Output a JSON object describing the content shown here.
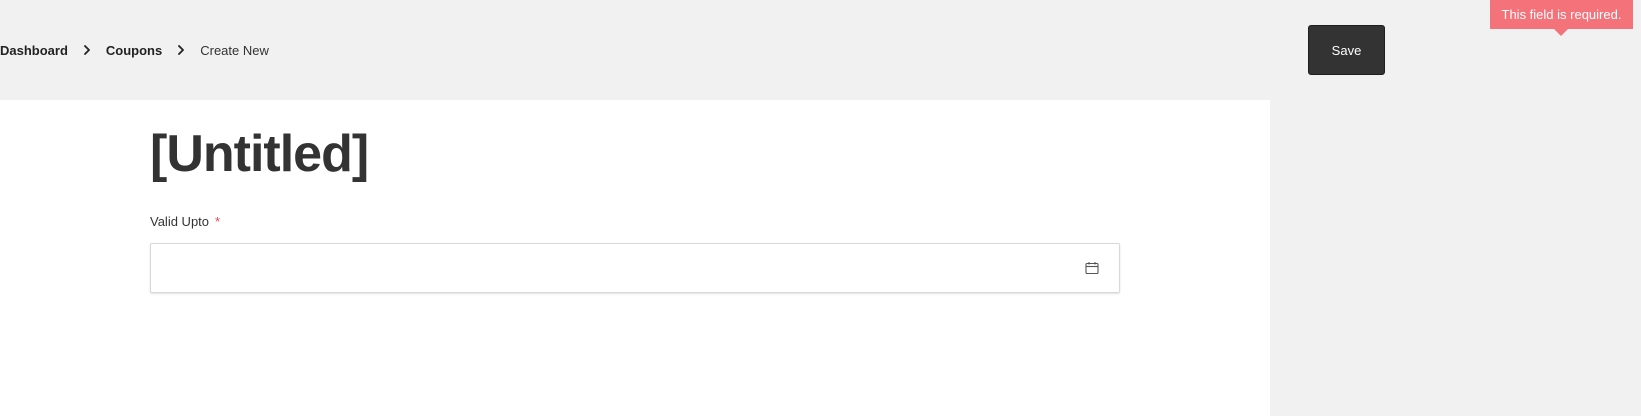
{
  "breadcrumb": {
    "items": [
      {
        "label": "Dashboard"
      },
      {
        "label": "Coupons"
      },
      {
        "label": "Create New"
      }
    ]
  },
  "toolbar": {
    "save_label": "Save"
  },
  "tooltip": {
    "text": "This field is required."
  },
  "form": {
    "title": "[Untitled]",
    "fields": [
      {
        "label": "Valid Upto",
        "required_marker": "*",
        "value": "",
        "icon": "calendar-icon"
      }
    ]
  },
  "colors": {
    "background": "#f1f1f1",
    "card": "#ffffff",
    "primary_button": "#333333",
    "error": "#f4727a",
    "required": "#e5484d"
  }
}
